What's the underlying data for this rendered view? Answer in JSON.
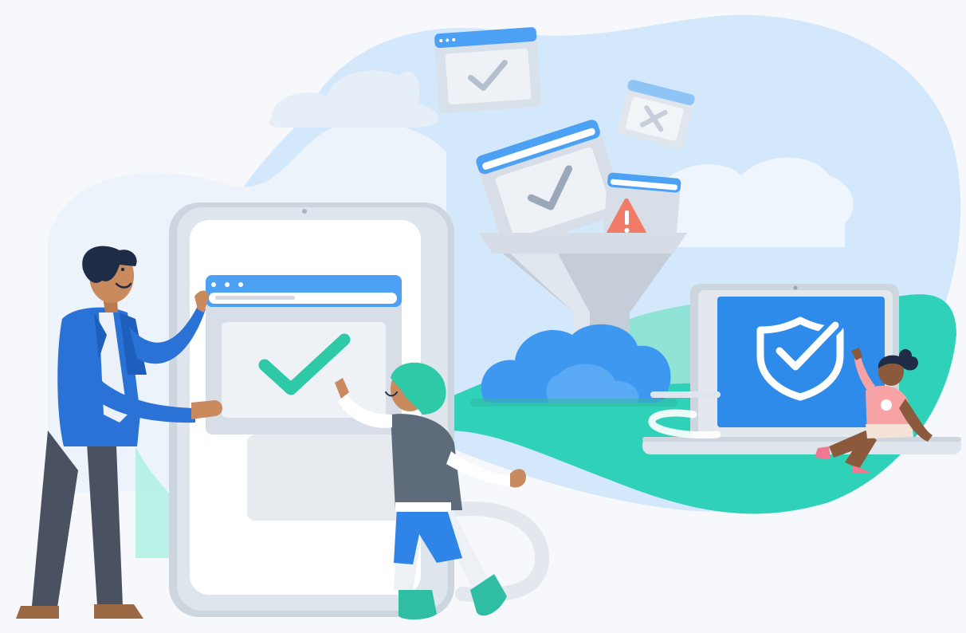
{
  "scene": {
    "subject": "web-filtering-illustration",
    "colors": {
      "background": "#f6f8fb",
      "sky_blob": "#cfe6fb",
      "sky_blob_dark": "#b9dbf8",
      "teal_ground": "#2ecfb8",
      "teal_light": "#9ee6da",
      "device_gray": "#dfe4ea",
      "device_border": "#c7cfd9",
      "window_blue": "#4da1f5",
      "check_teal": "#2ec9a6",
      "cloud_blue": "#3f98f0",
      "laptop_screen": "#2f8bea",
      "warning_red": "#f07c68",
      "suit_blue": "#2a72d6",
      "pants_dark": "#4a5160",
      "skin_tone": "#c98a5e"
    },
    "icons": [
      "check-window-icon",
      "blocked-window-icon",
      "warning-triangle-icon",
      "funnel-filter-icon",
      "cloud-icon",
      "shield-check-icon"
    ]
  }
}
